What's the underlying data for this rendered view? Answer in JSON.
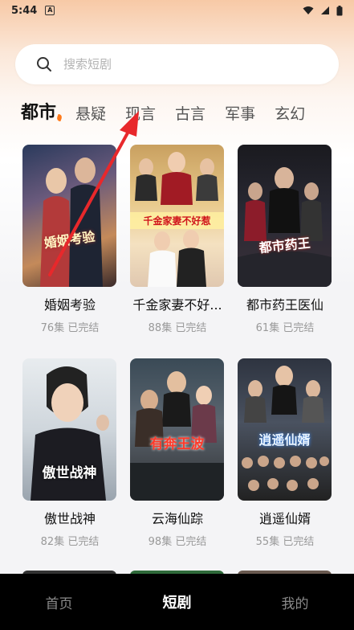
{
  "status_bar": {
    "time": "5:44",
    "notif_glyph": "A"
  },
  "search": {
    "placeholder": "搜索短剧",
    "icon": "search-icon"
  },
  "tabs": [
    {
      "label": "都市",
      "active": true
    },
    {
      "label": "悬疑",
      "active": false
    },
    {
      "label": "现言",
      "active": false
    },
    {
      "label": "古言",
      "active": false
    },
    {
      "label": "军事",
      "active": false
    },
    {
      "label": "玄幻",
      "active": false
    }
  ],
  "dramas": [
    {
      "title": "婚姻考验",
      "meta": "76集 已完结",
      "poster_text": "婚姻考验"
    },
    {
      "title": "千金家妻不好...",
      "meta": "88集 已完结",
      "poster_text": "千金家妻不好惹"
    },
    {
      "title": "都市药王医仙",
      "meta": "61集 已完结",
      "poster_text": "都市药王"
    },
    {
      "title": "傲世战神",
      "meta": "82集 已完结",
      "poster_text": "傲世战神"
    },
    {
      "title": "云海仙踪",
      "meta": "98集 已完结",
      "poster_text": "有奔王波"
    },
    {
      "title": "逍遥仙婿",
      "meta": "55集 已完结",
      "poster_text": "逍遥仙婿"
    }
  ],
  "bottom_nav": [
    {
      "label": "首页",
      "active": false
    },
    {
      "label": "短剧",
      "active": true
    },
    {
      "label": "我的",
      "active": false
    }
  ],
  "colors": {
    "accent": "#ff7a1a",
    "annotation_arrow": "#e8282b"
  }
}
